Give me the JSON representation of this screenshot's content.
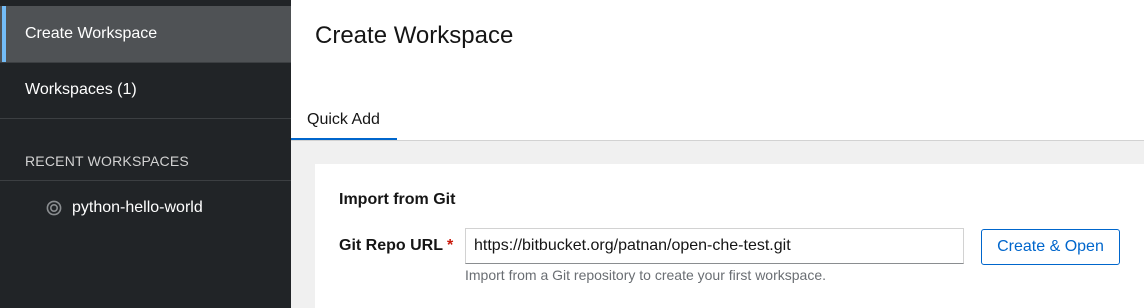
{
  "sidebar": {
    "items": [
      {
        "label": "Create Workspace",
        "active": true
      },
      {
        "label": "Workspaces (1)",
        "active": false
      }
    ],
    "recent_title": "RECENT WORKSPACES",
    "recent": [
      {
        "label": "python-hello-world",
        "icon": "workspace-status-icon"
      }
    ]
  },
  "main": {
    "title": "Create Workspace",
    "tabs": [
      {
        "label": "Quick Add",
        "active": true
      }
    ],
    "import_card": {
      "title": "Import from Git",
      "field_label": "Git Repo URL",
      "required_mark": "*",
      "url_value": "https://bitbucket.org/patnan/open-che-test.git",
      "helper_text": "Import from a Git repository to create your first workspace.",
      "button_label": "Create & Open"
    }
  },
  "colors": {
    "sidebar_bg": "#212427",
    "active_item_bg": "#4f5255",
    "active_indicator": "#73bcf7",
    "accent": "#0066cc",
    "required": "#c9190b"
  }
}
